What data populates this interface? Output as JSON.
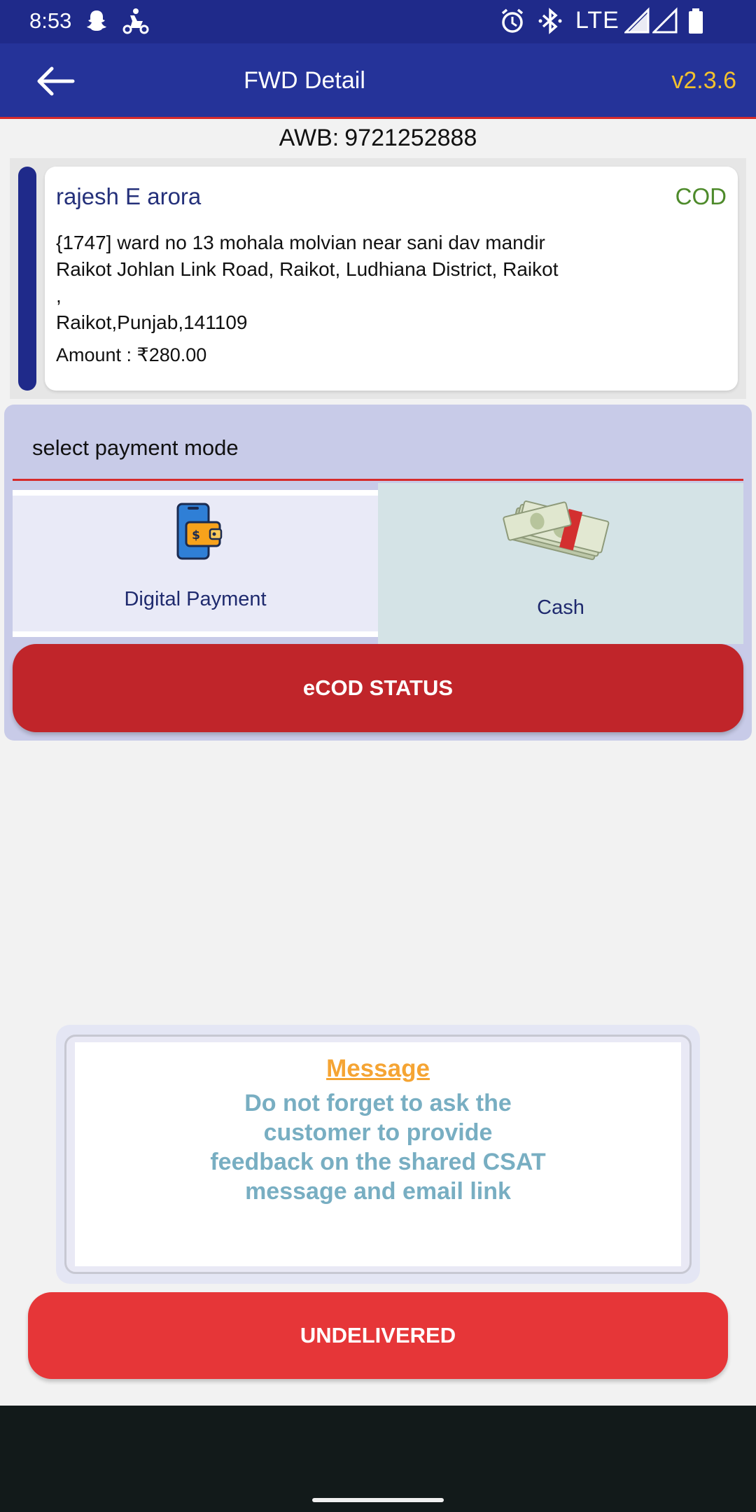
{
  "status_bar": {
    "time": "8:53",
    "network": "LTE",
    "icons": [
      "snapchat-icon",
      "delivery-app-icon",
      "alarm-icon",
      "bluetooth-icon",
      "signal-icon",
      "signal-icon",
      "battery-icon"
    ]
  },
  "app_bar": {
    "title": "FWD Detail",
    "version": "v2.3.6",
    "back_icon": "arrow-left-icon"
  },
  "awb": {
    "label": "AWB:",
    "number": "9721252888"
  },
  "shipment": {
    "customer_name": "rajesh E arora",
    "payment_type": "COD",
    "address_lines": [
      "{1747] ward no 13 mohala molvian near sani dav mandir",
      "Raikot Johlan Link Road, Raikot, Ludhiana District, Raikot",
      ",",
      "Raikot,Punjab,141109"
    ],
    "amount": "Amount : ₹280.00"
  },
  "payment": {
    "heading": "select payment mode",
    "options": [
      {
        "label": "Digital Payment",
        "icon": "phone-wallet-icon"
      },
      {
        "label": "Cash",
        "icon": "cash-bundle-icon"
      }
    ],
    "ecod_button": "eCOD STATUS"
  },
  "message": {
    "title": "Message",
    "lines": [
      "Do not forget to ask the",
      "customer to provide",
      "feedback on the shared CSAT",
      "message and email link"
    ]
  },
  "undelivered_button": "UNDELIVERED",
  "colors": {
    "primary": "#253399",
    "accent_red": "#d62b2b",
    "version": "#f2c12e",
    "cod": "#4d8a2a",
    "message_title": "#f5a433",
    "message_body": "#78aec2",
    "undelivered": "#e63638"
  }
}
